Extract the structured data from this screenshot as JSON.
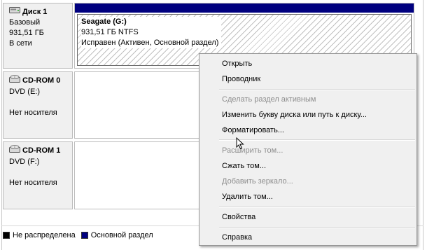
{
  "disks": [
    {
      "title": "Диск 1",
      "lines": [
        "Базовый",
        "931,51 ГБ",
        "В сети"
      ],
      "partition": {
        "name": "Seagate  (G:)",
        "size": "931,51 ГБ NTFS",
        "status": "Исправен (Активен, Основной раздел)"
      }
    },
    {
      "title": "CD-ROM 0",
      "lines": [
        "DVD (E:)",
        "",
        "Нет носителя"
      ]
    },
    {
      "title": "CD-ROM 1",
      "lines": [
        "DVD (F:)",
        "",
        "Нет носителя"
      ]
    }
  ],
  "legend": {
    "unallocated": "Не распределена",
    "primary": "Основной раздел"
  },
  "colors": {
    "primary": "#00007f",
    "unallocated": "#000000"
  },
  "menu": {
    "open": "Открыть",
    "explorer": "Проводник",
    "mark_active": "Сделать раздел активным",
    "change_letter": "Изменить букву диска или путь к диску...",
    "format": "Форматировать...",
    "extend": "Расширить том...",
    "shrink": "Сжать том...",
    "add_mirror": "Добавить зеркало...",
    "delete": "Удалить том...",
    "properties": "Свойства",
    "help": "Справка"
  }
}
